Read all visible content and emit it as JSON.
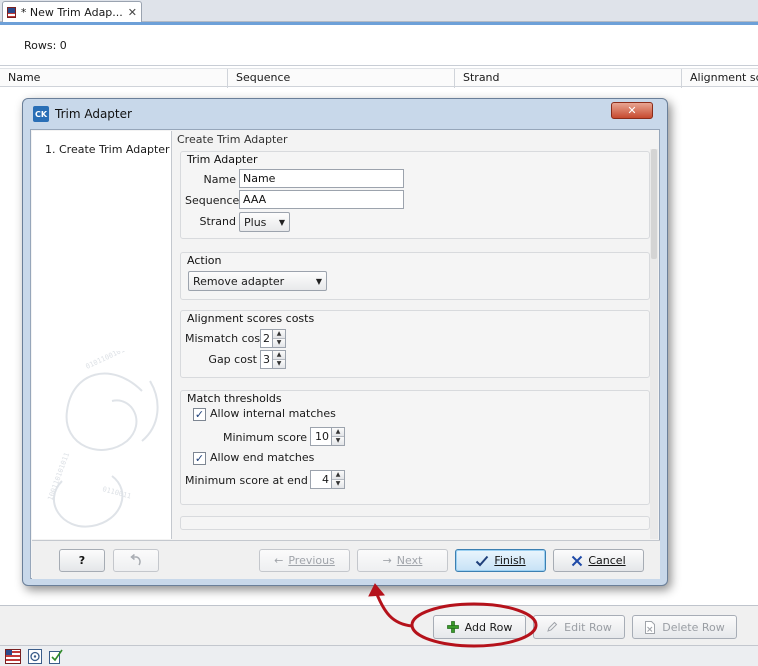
{
  "editor": {
    "tab_label": "* New Trim Adap...",
    "tab_close": "✕",
    "rows_label": "Rows: 0",
    "columns": [
      "Name",
      "Sequence",
      "Strand",
      "Alignment scor"
    ],
    "buttons": {
      "add_row": "Add Row",
      "edit_row": "Edit Row",
      "delete_row": "Delete Row"
    },
    "status_icons": [
      "table-view-icon",
      "info-view-icon",
      "history-icon"
    ]
  },
  "dialog": {
    "title": "Trim Adapter",
    "logo_text": "CK",
    "close_glyph": "✕",
    "steps": [
      {
        "label": "1.  Create Trim Adapter"
      }
    ],
    "content_title": "Create Trim Adapter",
    "trim_adapter": {
      "title": "Trim Adapter",
      "name_label": "Name",
      "name_value": "Name",
      "sequence_label": "Sequence",
      "sequence_value": "AAA",
      "strand_label": "Strand",
      "strand_value": "Plus"
    },
    "action": {
      "title": "Action",
      "value": "Remove adapter"
    },
    "alignment": {
      "title": "Alignment scores costs",
      "mismatch_label": "Mismatch cost",
      "mismatch_value": "2",
      "gap_label": "Gap cost",
      "gap_value": "3"
    },
    "thresholds": {
      "title": "Match thresholds",
      "internal_label": "Allow internal matches",
      "internal_checked": true,
      "min_score_label": "Minimum score",
      "min_score_value": "10",
      "end_label": "Allow end matches",
      "end_checked": true,
      "min_end_label": "Minimum score at end",
      "min_end_value": "4"
    },
    "footer": {
      "help": "?",
      "previous": "Previous",
      "next": "Next",
      "finish": "Finish",
      "cancel": "Cancel"
    }
  },
  "colors": {
    "accent_blue": "#6da0d8",
    "annotation_red": "#b5121b",
    "add_icon_green": "#3a9a2a",
    "cancel_icon_blue": "#1f4aa8"
  }
}
